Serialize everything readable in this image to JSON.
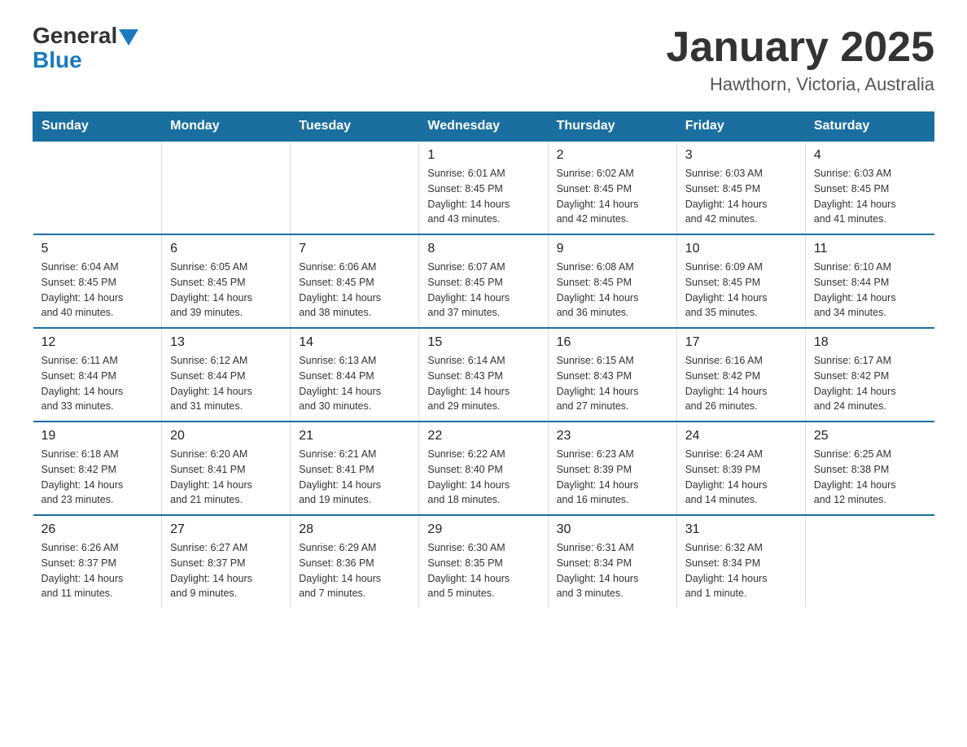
{
  "header": {
    "logo_general": "General",
    "logo_blue": "Blue",
    "title": "January 2025",
    "subtitle": "Hawthorn, Victoria, Australia"
  },
  "calendar": {
    "days_of_week": [
      "Sunday",
      "Monday",
      "Tuesday",
      "Wednesday",
      "Thursday",
      "Friday",
      "Saturday"
    ],
    "weeks": [
      [
        {
          "day": "",
          "info": ""
        },
        {
          "day": "",
          "info": ""
        },
        {
          "day": "",
          "info": ""
        },
        {
          "day": "1",
          "info": "Sunrise: 6:01 AM\nSunset: 8:45 PM\nDaylight: 14 hours\nand 43 minutes."
        },
        {
          "day": "2",
          "info": "Sunrise: 6:02 AM\nSunset: 8:45 PM\nDaylight: 14 hours\nand 42 minutes."
        },
        {
          "day": "3",
          "info": "Sunrise: 6:03 AM\nSunset: 8:45 PM\nDaylight: 14 hours\nand 42 minutes."
        },
        {
          "day": "4",
          "info": "Sunrise: 6:03 AM\nSunset: 8:45 PM\nDaylight: 14 hours\nand 41 minutes."
        }
      ],
      [
        {
          "day": "5",
          "info": "Sunrise: 6:04 AM\nSunset: 8:45 PM\nDaylight: 14 hours\nand 40 minutes."
        },
        {
          "day": "6",
          "info": "Sunrise: 6:05 AM\nSunset: 8:45 PM\nDaylight: 14 hours\nand 39 minutes."
        },
        {
          "day": "7",
          "info": "Sunrise: 6:06 AM\nSunset: 8:45 PM\nDaylight: 14 hours\nand 38 minutes."
        },
        {
          "day": "8",
          "info": "Sunrise: 6:07 AM\nSunset: 8:45 PM\nDaylight: 14 hours\nand 37 minutes."
        },
        {
          "day": "9",
          "info": "Sunrise: 6:08 AM\nSunset: 8:45 PM\nDaylight: 14 hours\nand 36 minutes."
        },
        {
          "day": "10",
          "info": "Sunrise: 6:09 AM\nSunset: 8:45 PM\nDaylight: 14 hours\nand 35 minutes."
        },
        {
          "day": "11",
          "info": "Sunrise: 6:10 AM\nSunset: 8:44 PM\nDaylight: 14 hours\nand 34 minutes."
        }
      ],
      [
        {
          "day": "12",
          "info": "Sunrise: 6:11 AM\nSunset: 8:44 PM\nDaylight: 14 hours\nand 33 minutes."
        },
        {
          "day": "13",
          "info": "Sunrise: 6:12 AM\nSunset: 8:44 PM\nDaylight: 14 hours\nand 31 minutes."
        },
        {
          "day": "14",
          "info": "Sunrise: 6:13 AM\nSunset: 8:44 PM\nDaylight: 14 hours\nand 30 minutes."
        },
        {
          "day": "15",
          "info": "Sunrise: 6:14 AM\nSunset: 8:43 PM\nDaylight: 14 hours\nand 29 minutes."
        },
        {
          "day": "16",
          "info": "Sunrise: 6:15 AM\nSunset: 8:43 PM\nDaylight: 14 hours\nand 27 minutes."
        },
        {
          "day": "17",
          "info": "Sunrise: 6:16 AM\nSunset: 8:42 PM\nDaylight: 14 hours\nand 26 minutes."
        },
        {
          "day": "18",
          "info": "Sunrise: 6:17 AM\nSunset: 8:42 PM\nDaylight: 14 hours\nand 24 minutes."
        }
      ],
      [
        {
          "day": "19",
          "info": "Sunrise: 6:18 AM\nSunset: 8:42 PM\nDaylight: 14 hours\nand 23 minutes."
        },
        {
          "day": "20",
          "info": "Sunrise: 6:20 AM\nSunset: 8:41 PM\nDaylight: 14 hours\nand 21 minutes."
        },
        {
          "day": "21",
          "info": "Sunrise: 6:21 AM\nSunset: 8:41 PM\nDaylight: 14 hours\nand 19 minutes."
        },
        {
          "day": "22",
          "info": "Sunrise: 6:22 AM\nSunset: 8:40 PM\nDaylight: 14 hours\nand 18 minutes."
        },
        {
          "day": "23",
          "info": "Sunrise: 6:23 AM\nSunset: 8:39 PM\nDaylight: 14 hours\nand 16 minutes."
        },
        {
          "day": "24",
          "info": "Sunrise: 6:24 AM\nSunset: 8:39 PM\nDaylight: 14 hours\nand 14 minutes."
        },
        {
          "day": "25",
          "info": "Sunrise: 6:25 AM\nSunset: 8:38 PM\nDaylight: 14 hours\nand 12 minutes."
        }
      ],
      [
        {
          "day": "26",
          "info": "Sunrise: 6:26 AM\nSunset: 8:37 PM\nDaylight: 14 hours\nand 11 minutes."
        },
        {
          "day": "27",
          "info": "Sunrise: 6:27 AM\nSunset: 8:37 PM\nDaylight: 14 hours\nand 9 minutes."
        },
        {
          "day": "28",
          "info": "Sunrise: 6:29 AM\nSunset: 8:36 PM\nDaylight: 14 hours\nand 7 minutes."
        },
        {
          "day": "29",
          "info": "Sunrise: 6:30 AM\nSunset: 8:35 PM\nDaylight: 14 hours\nand 5 minutes."
        },
        {
          "day": "30",
          "info": "Sunrise: 6:31 AM\nSunset: 8:34 PM\nDaylight: 14 hours\nand 3 minutes."
        },
        {
          "day": "31",
          "info": "Sunrise: 6:32 AM\nSunset: 8:34 PM\nDaylight: 14 hours\nand 1 minute."
        },
        {
          "day": "",
          "info": ""
        }
      ]
    ]
  }
}
